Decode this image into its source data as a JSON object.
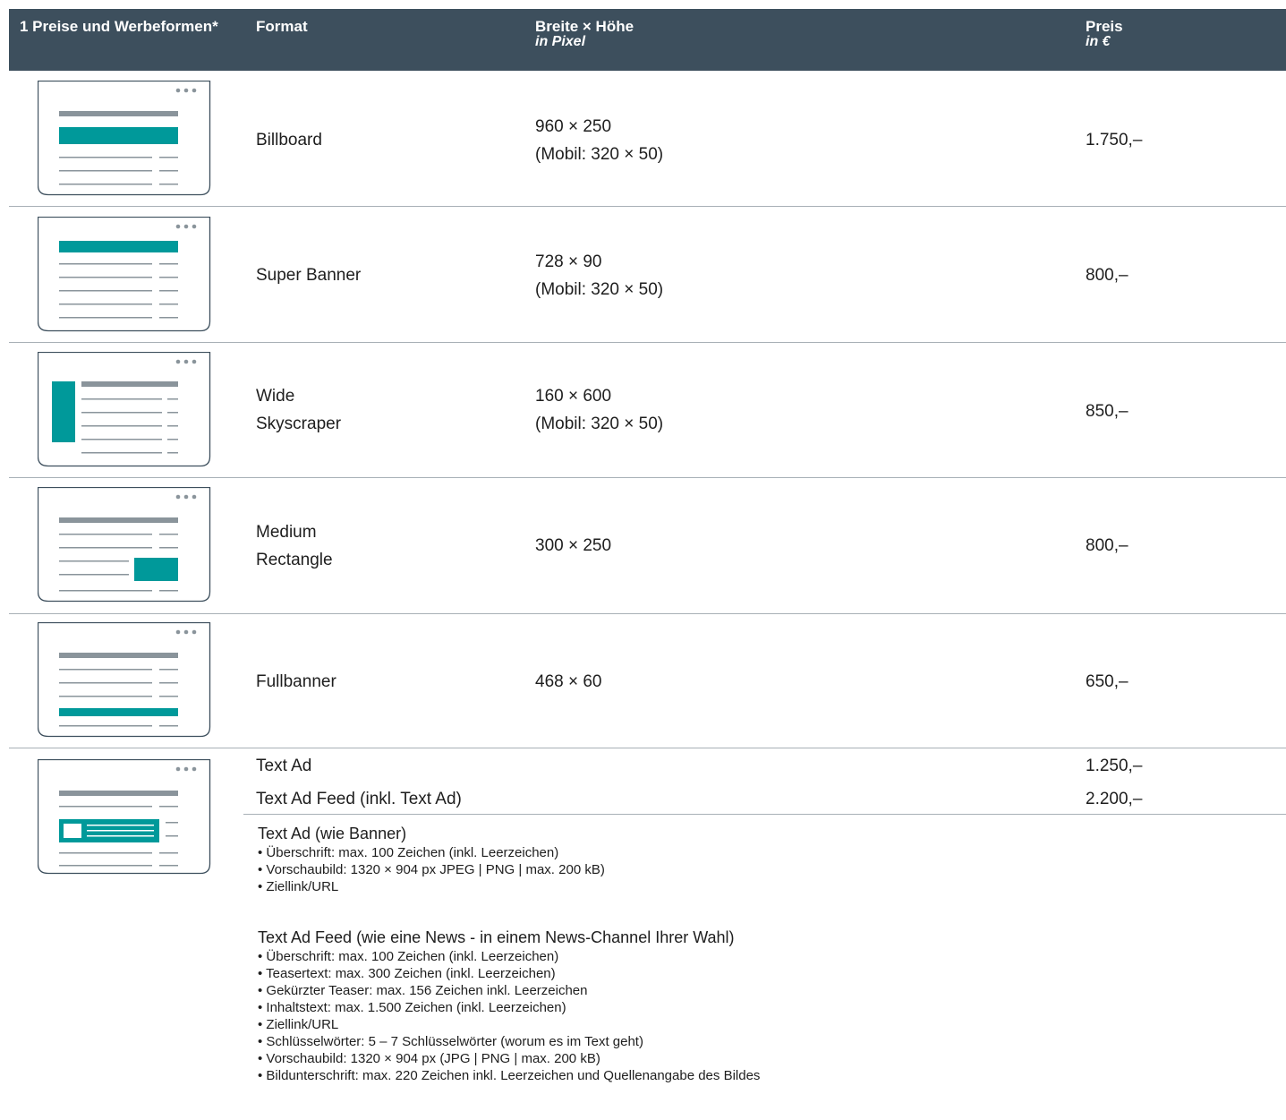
{
  "header": {
    "col1": "1 Preise und Werbeformen*",
    "col2": "Format",
    "col3": "Breite × Höhe",
    "col3_sub": "in Pixel",
    "col4": "Preis",
    "col4_sub": "in €"
  },
  "colors": {
    "header_bg": "#3d4f5d",
    "accent": "#00999a",
    "line": "#8a949b"
  },
  "rows": [
    {
      "icon": "billboard-icon",
      "format": "Billboard",
      "size": "960 × 250",
      "size_mobile": "(Mobil: 320 × 50)",
      "price": "1.750,–"
    },
    {
      "icon": "super-banner-icon",
      "format": "Super Banner",
      "size": "728 × 90",
      "size_mobile": "(Mobil: 320 × 50)",
      "price": "800,–"
    },
    {
      "icon": "wide-skyscraper-icon",
      "format_line1": "Wide",
      "format_line2": "Skyscraper",
      "size": "160 × 600",
      "size_mobile": "(Mobil: 320 × 50)",
      "price": "850,–"
    },
    {
      "icon": "medium-rectangle-icon",
      "format_line1": "Medium",
      "format_line2": "Rectangle",
      "size": "300 × 250",
      "price": "800,–"
    },
    {
      "icon": "fullbanner-icon",
      "format": "Fullbanner",
      "size": "468 × 60",
      "price": "650,–"
    }
  ],
  "textad": {
    "icon": "text-ad-icon",
    "item1": {
      "label": "Text Ad",
      "price": "1.250,–"
    },
    "item2": {
      "label": "Text Ad Feed (inkl. Text Ad)",
      "price": "2.200,–"
    },
    "block1": {
      "title": "Text Ad (wie Banner)",
      "items": [
        "Überschrift: max. 100 Zeichen (inkl. Leerzeichen)",
        "Vorschaubild: 1320 × 904 px JPEG | PNG | max. 200 kB)",
        "Ziellink/URL"
      ]
    },
    "block2": {
      "title": "Text Ad Feed (wie eine News - in einem News-Channel Ihrer Wahl)",
      "items": [
        "Überschrift: max. 100 Zeichen (inkl. Leerzeichen)",
        "Teasertext: max. 300 Zeichen (inkl. Leerzeichen)",
        "Gekürzter Teaser: max. 156 Zeichen inkl. Leerzeichen",
        "Inhaltstext: max. 1.500 Zeichen (inkl. Leerzeichen)",
        "Ziellink/URL",
        "Schlüsselwörter: 5 – 7 Schlüsselwörter (worum es im Text geht)",
        "Vorschaubild: 1320 × 904 px (JPG | PNG | max. 200 kB)",
        "Bildunterschrift: max. 220 Zeichen inkl. Leerzeichen und Quellenangabe des Bildes"
      ]
    }
  }
}
